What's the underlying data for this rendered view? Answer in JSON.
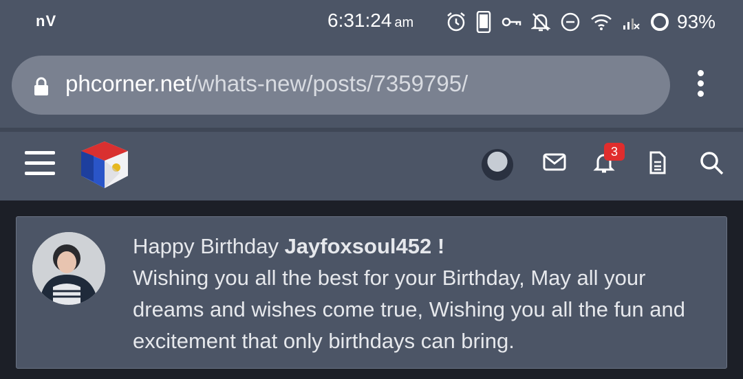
{
  "status_bar": {
    "carrier": "nV",
    "time": "6:31:24",
    "ampm": "am",
    "battery": "93%",
    "icons": [
      "alarm-icon",
      "phone-icon",
      "vpn-key-icon",
      "notifications-off-icon",
      "do-not-disturb-icon",
      "wifi-icon",
      "signal-icon",
      "battery-ring-icon"
    ]
  },
  "browser": {
    "url_domain": "phcorner.net",
    "url_path": "/whats-new/posts/7359795/"
  },
  "header": {
    "notification_count": "3",
    "icons": [
      "menu-icon",
      "site-logo",
      "user-avatar",
      "mail-icon",
      "bell-icon",
      "document-icon",
      "search-icon"
    ]
  },
  "card": {
    "greeting_prefix": "Happy Birthday ",
    "username": "Jayfoxsoul452 !",
    "message": "Wishing you all the best for your Birthday, May all your dreams and wishes come true, Wishing you all the fun and excitement that only birthdays can bring."
  },
  "colors": {
    "bar_bg": "#4c5566",
    "url_pill": "#7a8190",
    "page_bg": "#1c1f27",
    "badge": "#e02d2d"
  }
}
